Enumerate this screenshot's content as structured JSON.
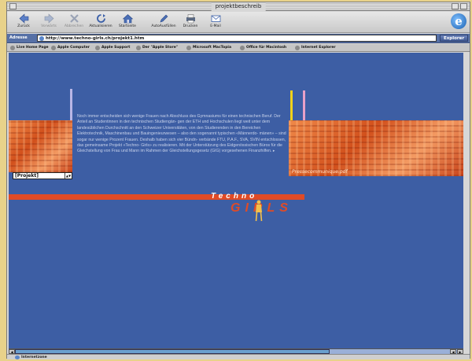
{
  "window": {
    "title": "projektbeschreib"
  },
  "toolbar": {
    "buttons": [
      {
        "label": "Zurück",
        "icon": "back-arrow-icon"
      },
      {
        "label": "Vorwärts",
        "icon": "forward-arrow-icon"
      },
      {
        "label": "Abbrechen",
        "icon": "stop-x-icon"
      },
      {
        "label": "Aktualisieren",
        "icon": "refresh-icon"
      },
      {
        "label": "Startseite",
        "icon": "home-icon"
      },
      {
        "label": "AutoAusfüllen",
        "icon": "autofill-pen-icon"
      },
      {
        "label": "Drucken",
        "icon": "print-icon"
      },
      {
        "label": "E-Mail",
        "icon": "mail-icon"
      }
    ]
  },
  "address": {
    "label": "Adresse",
    "url": "http://www.techno-girls.ch/projekt1.htm",
    "go_label": "Explorer"
  },
  "favorites": [
    "Live Home Page",
    "Apple Computer",
    "Apple Support",
    "Der \"Apple Store\"",
    "Microsoft MacTopia",
    "Office für Macintosh",
    "Internet Explorer"
  ],
  "page": {
    "select_value": "[Projekt]",
    "body_text": "Noch immer entscheiden sich wenige Frauen nach Abschluss des Gymnasiums für einen technischen Beruf. Der Anteil an Studentinnen in den technischen Studiengän- gen der ETH und Hochschulen liegt weit unter dem landesüblichen Durchschnitt an den Schweizer Universitäten, von den Studierenden in den Bereichen Elektrotechnik, Maschinenbau und Bauingenieurwesen – also den sogenannt typischen «Männerdo- mänen» – sind sogar nur wenige Prozent Frauen. Deshalb haben sich vier Bündn- verbände FTU, P.A.F., SVA, SVIN entschlossen, das gemeinsame Projekt «Techno- Girls» zu realisieren. Mit der Unterstützung des Eidgenössischen Büros für die Gleichstellung von Frau und Mann im Rahmen der Gleichstellungsgesetz (GIG) vorgesehenen Finanzhilfen. ▸",
    "caption": "Pressecommunique.pdf",
    "logo_top": "Techno",
    "logo_bottom": "GIRLS"
  },
  "status": {
    "zone": "Internetzone"
  },
  "colors": {
    "page_bg": "#3d5ea4",
    "accent_red": "#e04b26",
    "stripe_yellow": "#f2d21a",
    "stripe_pink": "#e7a0c8",
    "stripe_lavender": "#b9b6e6"
  }
}
